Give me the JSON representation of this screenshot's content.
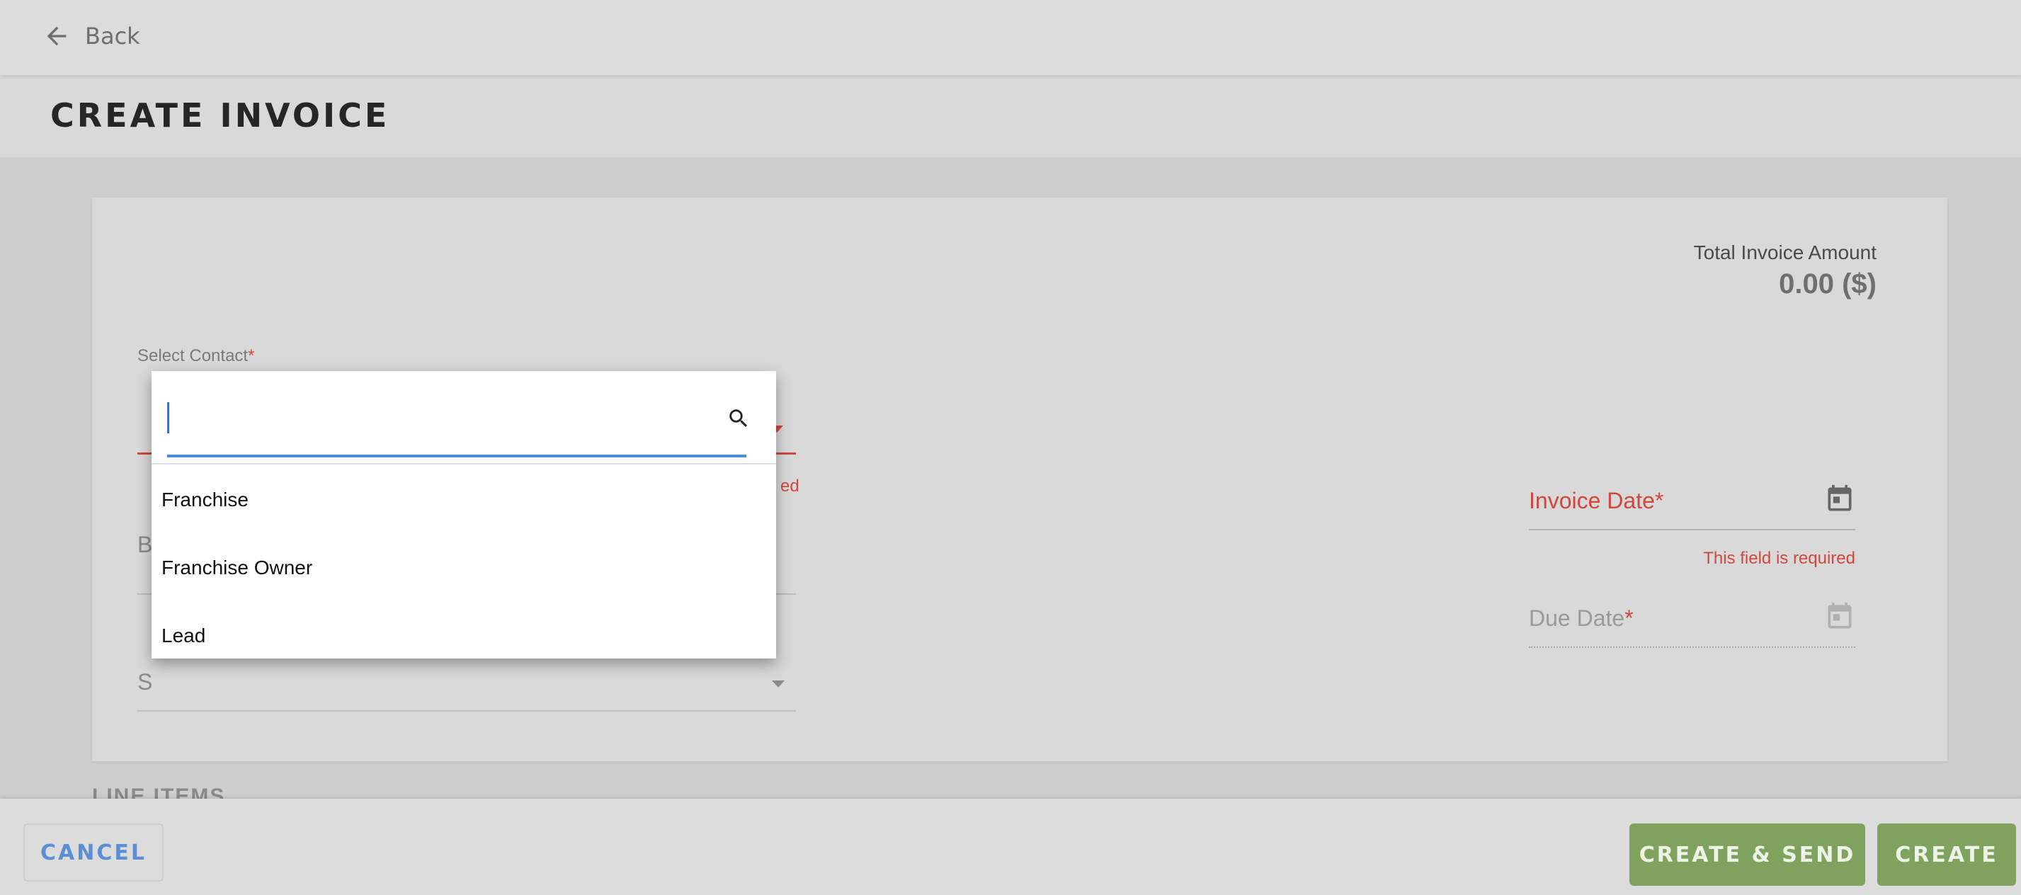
{
  "header": {
    "back_label": "Back"
  },
  "page": {
    "title": "CREATE INVOICE"
  },
  "summary": {
    "total_label": "Total Invoice Amount",
    "total_value": "0.00 ($)"
  },
  "form": {
    "contact": {
      "label": "Select Contact",
      "required_mark": "*",
      "error_fragment": "ed"
    },
    "billing_field_letter": "B",
    "second_select_letter": "S",
    "invoice_date": {
      "label": "Invoice Date*",
      "error": "This field is required"
    },
    "due_date": {
      "label": "Due Date",
      "required_mark": "*"
    },
    "section_line_items": "LINE ITEMS"
  },
  "dropdown": {
    "search_value": "",
    "options": [
      "Franchise",
      "Franchise Owner",
      "Lead"
    ]
  },
  "footer": {
    "cancel_label": "CANCEL",
    "create_send_label": "CREATE & SEND",
    "create_label": "CREATE"
  },
  "colors": {
    "error": "#d0483c",
    "primary_green": "#7fa35e",
    "cancel_blue": "#5a8fd4",
    "focus_blue": "#4a8ee0"
  }
}
